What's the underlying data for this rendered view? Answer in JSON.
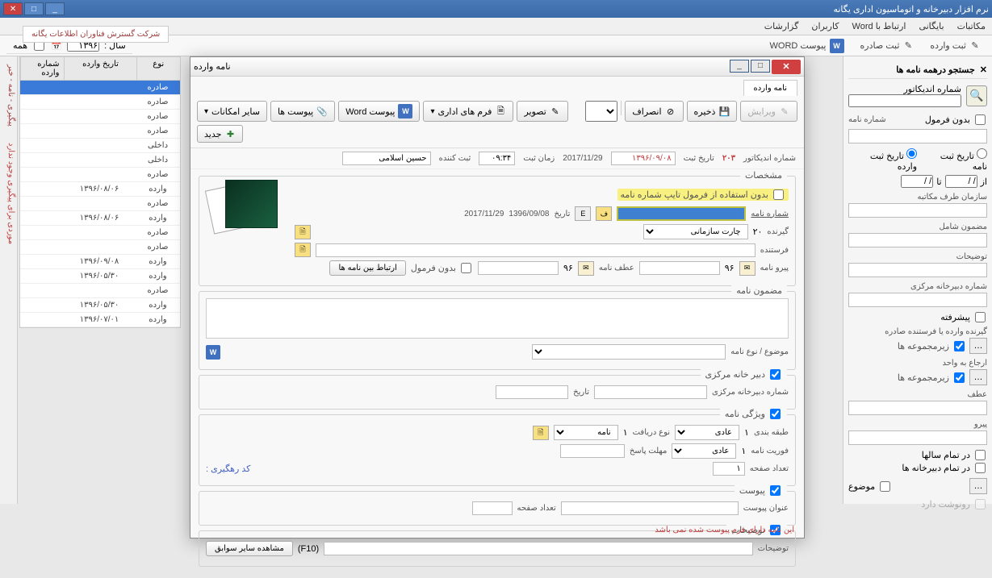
{
  "app": {
    "title": "نرم افزار دبیرخانه و اتوماسیون اداری یگانه"
  },
  "menu": {
    "mail": "مکاتبات",
    "archive": "بایگانی",
    "word": "ارتباط با Word",
    "users": "کاربران",
    "reports": "گزارشات"
  },
  "toolbar": {
    "incoming": "ثبت وارده",
    "outgoing": "ثبت صادره",
    "word_attach": "پیوست WORD",
    "year_label": "سال :",
    "year_value": "۱۳۹۶",
    "all": "همه"
  },
  "search": {
    "title": "جستجو درهمه نامه ها",
    "indicator": "شماره اندیکاتور",
    "letter_no": "شماره نامه",
    "no_formula": "بدون فرمول",
    "reg_date": "تاریخ ثبت نامه",
    "inc_date": "تاریخ ثبت وارده",
    "from": "از",
    "to": "تا",
    "org": "سازمان طرف مکاتبه",
    "subject": "مضمون شامل",
    "notes": "توضیحات",
    "central_no": "شماره دبیرخانه مرکزی",
    "advanced": "پیشرفته",
    "outgoing_sender": "گیرنده وارده یا فرستنده صادره",
    "subsets": "زیرمجموعه ها",
    "refer_to": "ارجاع به واحد",
    "subsets2": "زیرمجموعه ها",
    "atf": "عطف",
    "peyro": "پیرو",
    "all_years": "در تمام سالها",
    "all_secs": "در تمام دبیرخانه ها",
    "subject2": "موضوع",
    "has_copy": "رونوشت دارد"
  },
  "table": {
    "h_type": "نوع",
    "h_date": "تاریخ وارده",
    "h_no": "شماره وارده",
    "rows": [
      {
        "type": "صادره",
        "date": ""
      },
      {
        "type": "صادره",
        "date": ""
      },
      {
        "type": "صادره",
        "date": ""
      },
      {
        "type": "صادره",
        "date": ""
      },
      {
        "type": "داخلی",
        "date": ""
      },
      {
        "type": "داخلی",
        "date": ""
      },
      {
        "type": "صادره",
        "date": ""
      },
      {
        "type": "وارده",
        "date": "۱۳۹۶/۰۸/۰۶"
      },
      {
        "type": "صادره",
        "date": ""
      },
      {
        "type": "وارده",
        "date": "۱۳۹۶/۰۸/۰۶"
      },
      {
        "type": "صادره",
        "date": ""
      },
      {
        "type": "صادره",
        "date": ""
      },
      {
        "type": "وارده",
        "date": "۱۳۹۶/۰۹/۰۸"
      },
      {
        "type": "وارده",
        "date": "۱۳۹۶/۰۵/۳۰"
      },
      {
        "type": "صادره",
        "date": ""
      },
      {
        "type": "وارده",
        "date": "۱۳۹۶/۰۵/۳۰"
      },
      {
        "type": "وارده",
        "date": "۱۳۹۶/۰۷/۰۱"
      }
    ]
  },
  "company": "شرکت گسترش فناوران اطلاعات یگانه",
  "vtab1": "پیگیری - نامه - خبر",
  "vtab2": "موردی برای پیگیری وجود ندارد",
  "dialog": {
    "title": "نامه وارده",
    "tab": "نامه وارده",
    "btn_new": "جدید",
    "btn_edit": "ویرایش",
    "btn_save": "ذخیره",
    "btn_cancel": "انصراف",
    "btn_image": "تصویر",
    "btn_forms": "فرم های اداری",
    "btn_word": "پیوست Word",
    "btn_attach": "پیوست ها",
    "btn_other": "سایر امکانات",
    "indicator_lbl": "شماره اندیکاتور",
    "indicator_val": "۲۰۳",
    "reg_date_lbl": "تاریخ ثبت",
    "reg_date_val": "۱۳۹۶/۰۹/۰۸",
    "reg_time_lbl": "زمان ثبت",
    "reg_time_val": "۰۹:۳۴",
    "reg_by_lbl": "ثبت کننده",
    "reg_by_val": "حسین اسلامی",
    "greg_date": "2017/11/29",
    "sec_specs": "مشخصات",
    "no_formula_chk": "بدون استفاده از فرمول تایپ شماره نامه",
    "letter_no_lbl": "شماره نامه",
    "date_lbl": "تاریخ",
    "date_fa": "1396/09/08",
    "date_en": "2017/11/29",
    "receiver_lbl": "گیرنده",
    "receiver_no": "۲۰",
    "org_chart": "چارت سازمانی",
    "sender_lbl": "فرستنده",
    "peyro_lbl": "پیرو نامه",
    "atf_lbl": "عطف نامه",
    "no_formula2": "بدون فرمول",
    "link_letters": "ارتباط بین نامه ها",
    "num96": "۹۶",
    "sec_content": "مضمون نامه",
    "subject_type": "موضوع / نوع نامه",
    "sec_central": "دبیر خانه مرکزی",
    "central_no": "شماره دبیرخانه مرکزی",
    "central_date": "تاریخ",
    "sec_attrs": "ویژگی نامه",
    "class_lbl": "طبقه بندی",
    "normal": "عادی",
    "one": "۱",
    "recv_type": "نوع دریافت",
    "letter_type": "نامه",
    "urgency": "فوریت نامه",
    "reply_deadline": "مهلت پاسخ",
    "pages": "تعداد صفحه",
    "track_code": "کد رهگیری :",
    "sec_attach": "پیوست",
    "attach_title": "عنوان پیوست",
    "attach_pages": "تعداد صفحه",
    "sec_notes": "توضیحات",
    "notes_lbl": "توضیحات",
    "f10": "(F10)",
    "view_history": "مشاهده سایر سوابق",
    "footer": "این نامه دارای فرم پیوست شده نمی باشد"
  }
}
